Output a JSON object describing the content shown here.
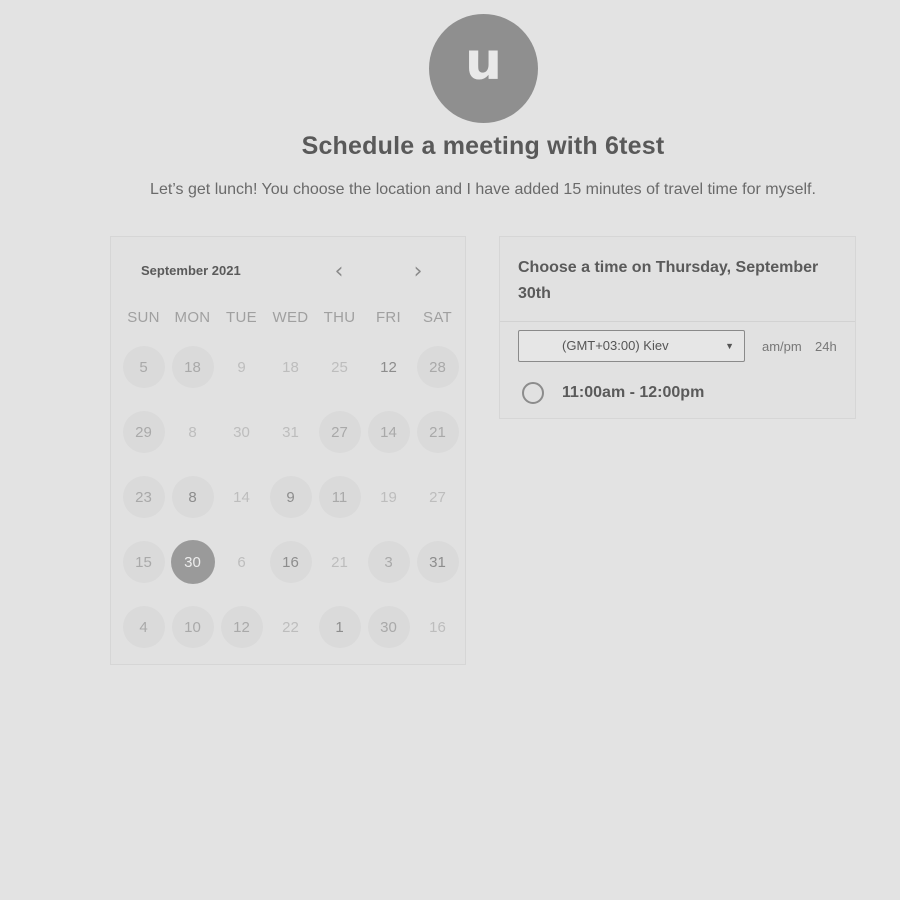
{
  "avatar": {
    "initial": "u"
  },
  "header": {
    "title": "Schedule a meeting with 6test",
    "description": "Let’s get lunch! You choose the location and I have added 15 minutes of travel time for myself."
  },
  "calendar": {
    "month": "September 2021",
    "prev_icon": "chevron-left-icon",
    "next_icon": "chevron-right-icon",
    "weekdays": [
      "SUN",
      "MON",
      "TUE",
      "WED",
      "THU",
      "FRI",
      "SAT"
    ],
    "weeks": [
      [
        {
          "d": "5",
          "avail": true
        },
        {
          "d": "18",
          "avail": true
        },
        {
          "d": "9",
          "avail": false
        },
        {
          "d": "18",
          "avail": false
        },
        {
          "d": "25",
          "avail": false
        },
        {
          "d": "12",
          "avail": false,
          "dark": true
        },
        {
          "d": "28",
          "avail": true
        }
      ],
      [
        {
          "d": "29",
          "avail": true
        },
        {
          "d": "8",
          "avail": false
        },
        {
          "d": "30",
          "avail": false
        },
        {
          "d": "31",
          "avail": false
        },
        {
          "d": "27",
          "avail": true
        },
        {
          "d": "14",
          "avail": true
        },
        {
          "d": "21",
          "avail": true
        }
      ],
      [
        {
          "d": "23",
          "avail": true
        },
        {
          "d": "8",
          "avail": true,
          "dark": true
        },
        {
          "d": "14",
          "avail": false
        },
        {
          "d": "9",
          "avail": true,
          "dark": true
        },
        {
          "d": "11",
          "avail": true
        },
        {
          "d": "19",
          "avail": false
        },
        {
          "d": "27",
          "avail": false
        }
      ],
      [
        {
          "d": "15",
          "avail": true
        },
        {
          "d": "30",
          "avail": true,
          "selected": true
        },
        {
          "d": "6",
          "avail": false
        },
        {
          "d": "16",
          "avail": true,
          "dark": true
        },
        {
          "d": "21",
          "avail": false
        },
        {
          "d": "3",
          "avail": true
        },
        {
          "d": "31",
          "avail": true,
          "dark": true
        }
      ],
      [
        {
          "d": "4",
          "avail": true
        },
        {
          "d": "10",
          "avail": true
        },
        {
          "d": "12",
          "avail": true
        },
        {
          "d": "22",
          "avail": false
        },
        {
          "d": "1",
          "avail": true,
          "dark": true
        },
        {
          "d": "30",
          "avail": true
        },
        {
          "d": "16",
          "avail": false
        }
      ]
    ]
  },
  "time_panel": {
    "heading": "Choose a time on Thursday, September 30th",
    "timezone": "(GMT+03:00) Kiev",
    "format_ampm": "am/pm",
    "format_24h": "24h",
    "slots": [
      "11:00am - 12:00pm"
    ]
  }
}
